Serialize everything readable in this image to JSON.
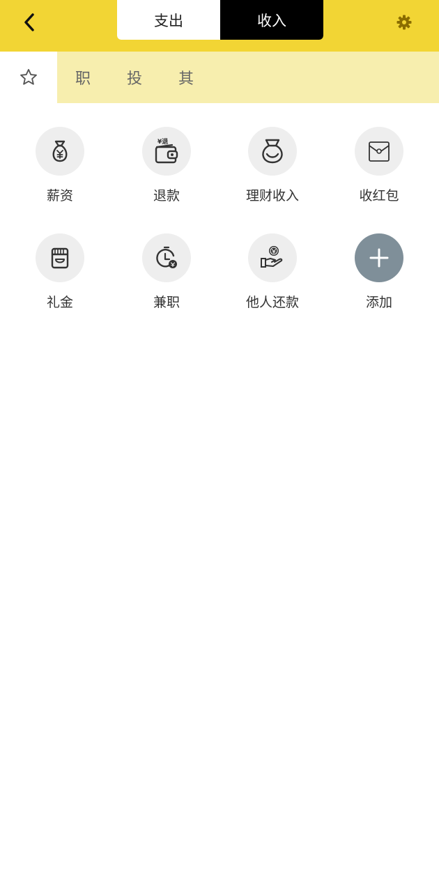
{
  "header": {
    "back_icon": "chevron-left-icon",
    "tabs": [
      {
        "label": "支出",
        "active": false
      },
      {
        "label": "收入",
        "active": true
      }
    ],
    "settings_icon": "gear-icon",
    "accent_color": "#f2d534"
  },
  "category_tabs": {
    "star_icon": "star-outline-icon",
    "items": [
      "职",
      "投",
      "其"
    ],
    "background_color": "#f7eeae"
  },
  "income_items": [
    {
      "label": "薪资",
      "icon": "money-bag-icon"
    },
    {
      "label": "退款",
      "icon": "refund-wallet-icon"
    },
    {
      "label": "理财收入",
      "icon": "investment-bag-icon"
    },
    {
      "label": "收红包",
      "icon": "red-envelope-icon"
    },
    {
      "label": "礼金",
      "icon": "gift-money-icon"
    },
    {
      "label": "兼职",
      "icon": "part-time-clock-icon"
    },
    {
      "label": "他人还款",
      "icon": "repayment-hand-icon"
    },
    {
      "label": "添加",
      "icon": "plus-icon"
    }
  ]
}
